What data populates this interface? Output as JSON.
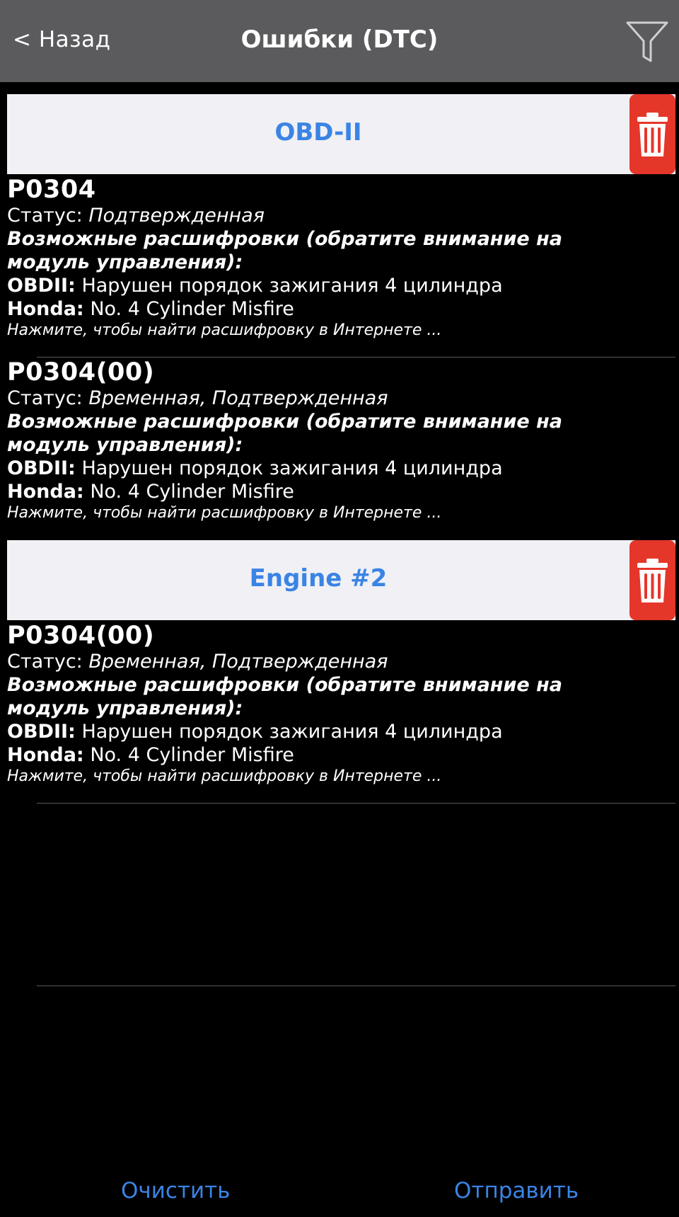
{
  "nav": {
    "back_label": "< Назад",
    "title": "Ошибки (DTC)",
    "filter_icon": "filter-icon"
  },
  "sections": [
    {
      "title": "OBD-II",
      "delete_icon": "trash-icon",
      "dtcs": [
        {
          "code": "P0304",
          "status_label": "Статус:",
          "status_value": "Подтвержденная",
          "decodings_title": "Возможные расшифровки (обратите внимание на модуль управления):",
          "obd_label": "OBDII:",
          "obd_value": "Нарушен порядок зажигания 4 цилиндра",
          "make_label": "Honda:",
          "make_value": "No. 4 Cylinder Misfire",
          "search_hint": "Нажмите, чтобы найти расшифровку в Интернете ..."
        },
        {
          "code": "P0304(00)",
          "status_label": "Статус:",
          "status_value": "Временная, Подтвержденная",
          "decodings_title": "Возможные расшифровки (обратите внимание на модуль управления):",
          "obd_label": "OBDII:",
          "obd_value": "Нарушен порядок зажигания 4 цилиндра",
          "make_label": "Honda:",
          "make_value": "No. 4 Cylinder Misfire",
          "search_hint": "Нажмите, чтобы найти расшифровку в Интернете ..."
        }
      ]
    },
    {
      "title": "Engine #2",
      "delete_icon": "trash-icon",
      "dtcs": [
        {
          "code": "P0304(00)",
          "status_label": "Статус:",
          "status_value": "Временная, Подтвержденная",
          "decodings_title": "Возможные расшифровки (обратите внимание на модуль управления):",
          "obd_label": "OBDII:",
          "obd_value": "Нарушен порядок зажигания 4 цилиндра",
          "make_label": "Honda:",
          "make_value": "No. 4 Cylinder Misfire",
          "search_hint": "Нажмите, чтобы найти расшифровку в Интернете ..."
        }
      ]
    }
  ],
  "toolbar": {
    "clear_label": "Очистить",
    "send_label": "Отправить"
  },
  "colors": {
    "navbar": "#5b5b5d",
    "accent": "#3a84e4",
    "delete": "#e5362a",
    "section_bg": "#f0f0f5"
  }
}
